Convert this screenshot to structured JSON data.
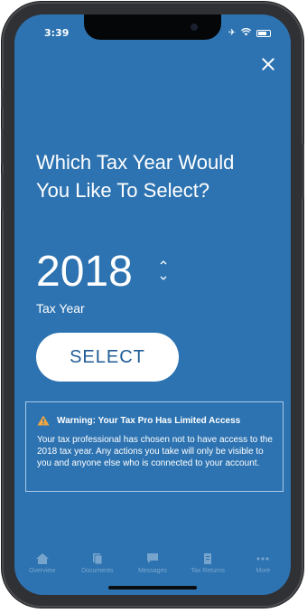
{
  "status_bar": {
    "time": "3:39",
    "icons": [
      "airplane-icon",
      "wifi-icon",
      "battery-icon"
    ]
  },
  "dialog": {
    "heading": "Which Tax Year Would You Like To Select?",
    "year_value": "2018",
    "year_label": "Tax Year",
    "select_label": "SELECT"
  },
  "warning": {
    "title": "Warning: Your Tax Pro Has Limited Access",
    "body": "Your tax professional has chosen not to have access to the 2018 tax year. Any actions you take will only be visible to you and anyone else who is connected to your account."
  },
  "tabbar": {
    "items": [
      {
        "label": "Overview",
        "icon": "home-icon"
      },
      {
        "label": "Documents",
        "icon": "documents-icon"
      },
      {
        "label": "Messages",
        "icon": "messages-icon"
      },
      {
        "label": "Tax Returns",
        "icon": "tax-returns-icon"
      },
      {
        "label": "More",
        "icon": "more-icon"
      }
    ]
  },
  "colors": {
    "background": "#2d73b1",
    "button_text": "#1f5c96",
    "warning_icon": "#f2a640"
  }
}
